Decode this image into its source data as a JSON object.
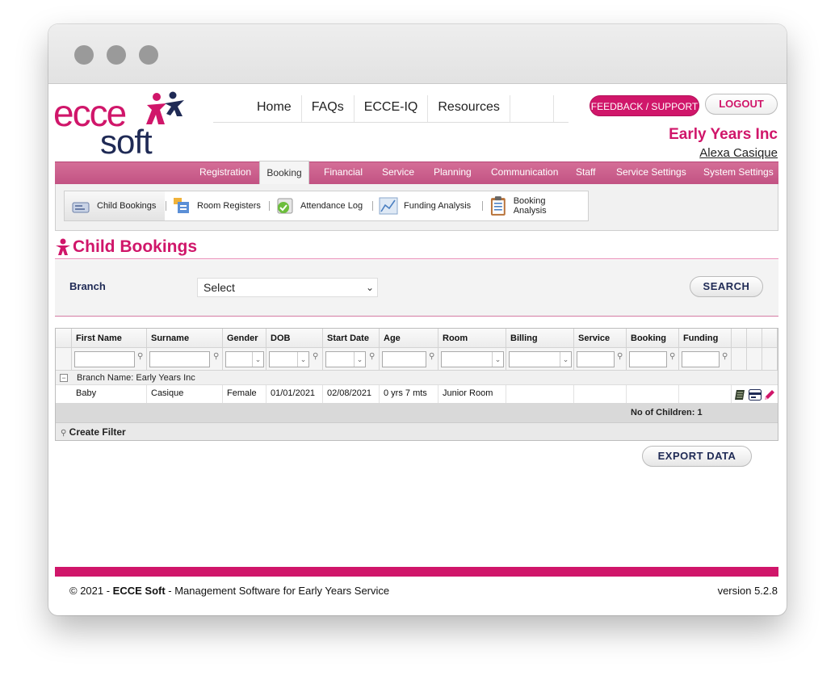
{
  "brand": {
    "logo_top": "ecce",
    "logo_bottom": "soft",
    "primary_color": "#d0166a",
    "navy_color": "#1f2a55"
  },
  "topnav": {
    "items": [
      "Home",
      "FAQs",
      "ECCE-IQ",
      "Resources"
    ]
  },
  "header": {
    "feedback_label": "FEEDBACK / SUPPORT",
    "logout_label": "LOGOUT",
    "org_name": "Early Years Inc",
    "user_name": "Alexa Casique"
  },
  "main_tabs": {
    "items": [
      "Registration",
      "Booking",
      "Financial",
      "Service",
      "Planning",
      "Communication",
      "Staff",
      "Service Settings",
      "System Settings"
    ],
    "active": "Booking"
  },
  "sub_tabs": {
    "items": [
      {
        "label": "Child Bookings",
        "icon": "child-card-icon"
      },
      {
        "label": "Room Registers",
        "icon": "register-icon"
      },
      {
        "label": "Attendance Log",
        "icon": "attendance-icon"
      },
      {
        "label": "Funding Analysis",
        "icon": "chart-icon"
      },
      {
        "label": "Booking Analysis",
        "icon": "clipboard-icon"
      }
    ],
    "active": "Child Bookings"
  },
  "page": {
    "title": "Child Bookings"
  },
  "search": {
    "branch_label": "Branch",
    "branch_value": "Select",
    "search_label": "SEARCH"
  },
  "grid": {
    "columns": [
      "First Name",
      "Surname",
      "Gender",
      "DOB",
      "Start Date",
      "Age",
      "Room",
      "Billing Scheme",
      "Service",
      "Booking",
      "Funding"
    ],
    "group_label": "Branch Name: Early Years Inc",
    "rows": [
      {
        "first_name": "Baby",
        "surname": "Casique",
        "gender": "Female",
        "dob": "01/01/2021",
        "start_date": "02/08/2021",
        "age": "0 yrs 7 mts",
        "room": "Junior Room",
        "billing_scheme": "",
        "service": "",
        "booking": "",
        "funding": ""
      }
    ],
    "summary": "No of Children: 1",
    "create_filter_label": "Create Filter"
  },
  "export": {
    "label": "EXPORT DATA"
  },
  "footer": {
    "copyright_prefix": "© 2021 - ",
    "copyright_brand": "ECCE Soft",
    "copyright_suffix": " - Management Software for Early Years Service",
    "version": "version 5.2.8"
  }
}
